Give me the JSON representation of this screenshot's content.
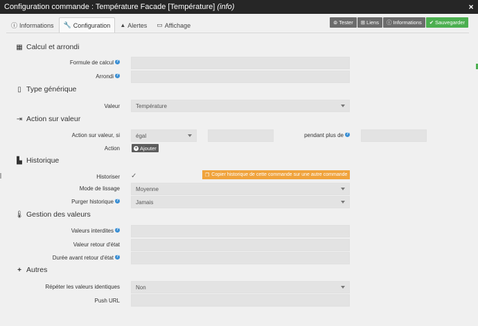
{
  "titlebar": {
    "prefix": "Configuration commande : ",
    "name": "Température Facade [Température]",
    "type": "(info)",
    "close": "×"
  },
  "tabs": [
    {
      "label": "Informations",
      "icon": "ⓘ"
    },
    {
      "label": "Configuration",
      "icon": "🔧"
    },
    {
      "label": "Alertes",
      "icon": "▲"
    },
    {
      "label": "Affichage",
      "icon": "▭"
    }
  ],
  "actions": {
    "tester": "Tester",
    "liens": "Liens",
    "informations": "Informations",
    "sauvegarder": "Sauvegarder"
  },
  "sections": {
    "calcul": "Calcul et arrondi",
    "type": "Type générique",
    "action": "Action sur valeur",
    "historique": "Historique",
    "gestion": "Gestion des valeurs",
    "autres": "Autres"
  },
  "fields": {
    "formule_label": "Formule de calcul",
    "formule_value": "",
    "arrondi_label": "Arrondi",
    "arrondi_value": "",
    "valeur_label": "Valeur",
    "valeur_value": "Température",
    "action_si_label": "Action sur valeur, si",
    "action_si_value": "égal",
    "action_si_operand": "",
    "pendant_label": "pendant plus de",
    "pendant_value": "",
    "action_label": "Action",
    "ajouter": "Ajouter",
    "historiser_label": "Historiser",
    "historiser_check": "✓",
    "copier": "Copier historique de cette commande sur une autre commande",
    "lissage_label": "Mode de lissage",
    "lissage_value": "Moyenne",
    "purger_label": "Purger historique",
    "purger_value": "Jamais",
    "interdites_label": "Valeurs interdites",
    "interdites_value": "",
    "retour_label": "Valeur retour d'état",
    "retour_value": "",
    "duree_label": "Durée avant retour d'état",
    "duree_value": "",
    "repeter_label": "Répéter les valeurs identiques",
    "repeter_value": "Non",
    "push_label": "Push URL",
    "push_value": ""
  },
  "help_icon": "?"
}
